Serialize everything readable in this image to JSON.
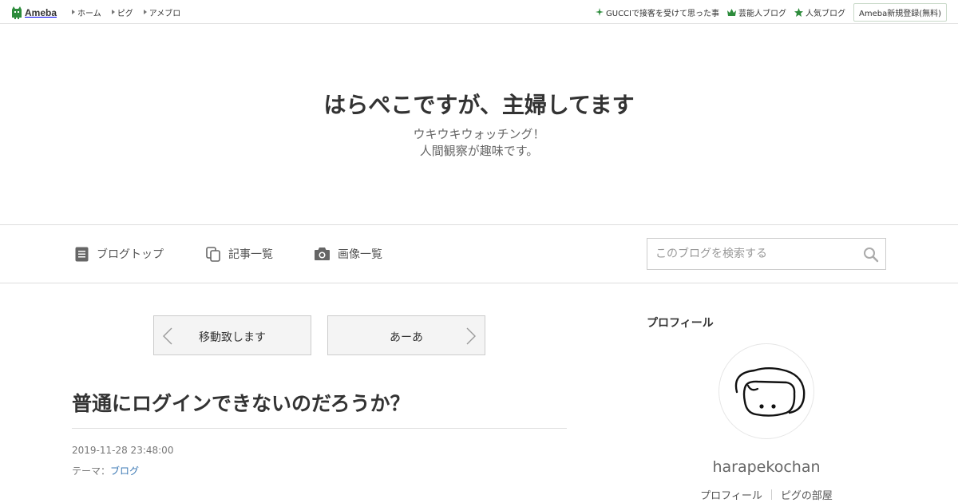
{
  "topbar": {
    "logo_text": "Ameba",
    "nav": [
      {
        "label": "ホーム"
      },
      {
        "label": "ピグ"
      },
      {
        "label": "アメブロ"
      }
    ],
    "right_links": [
      {
        "label": "GUCCIで接客を受けて思った事",
        "icon": "sparkle-icon"
      },
      {
        "label": "芸能人ブログ",
        "icon": "crown-icon"
      },
      {
        "label": "人気ブログ",
        "icon": "star-icon"
      }
    ],
    "register_label": "Ameba新規登録(無料)",
    "accent_color": "#2d8c3c"
  },
  "header": {
    "title": "はらぺこですが、主婦してます",
    "description_line1": "ウキウキウォッチング！",
    "description_line2": "人間観察が趣味です。"
  },
  "navbar": {
    "items": [
      {
        "label": "ブログトップ",
        "icon": "document-icon"
      },
      {
        "label": "記事一覧",
        "icon": "copy-icon"
      },
      {
        "label": "画像一覧",
        "icon": "camera-icon"
      }
    ],
    "search_placeholder": "このブログを検索する"
  },
  "pager": {
    "prev_label": "移動致します",
    "next_label": "あーあ"
  },
  "article": {
    "title": "普通にログインできないのだろうか？",
    "date": "2019-11-28 23:48:00",
    "theme_prefix": "テーマ：",
    "theme_link": "ブログ"
  },
  "sidebar": {
    "heading": "プロフィール",
    "username": "harapekochan",
    "links": [
      {
        "label": "プロフィール"
      },
      {
        "label": "ピグの部屋"
      }
    ]
  }
}
